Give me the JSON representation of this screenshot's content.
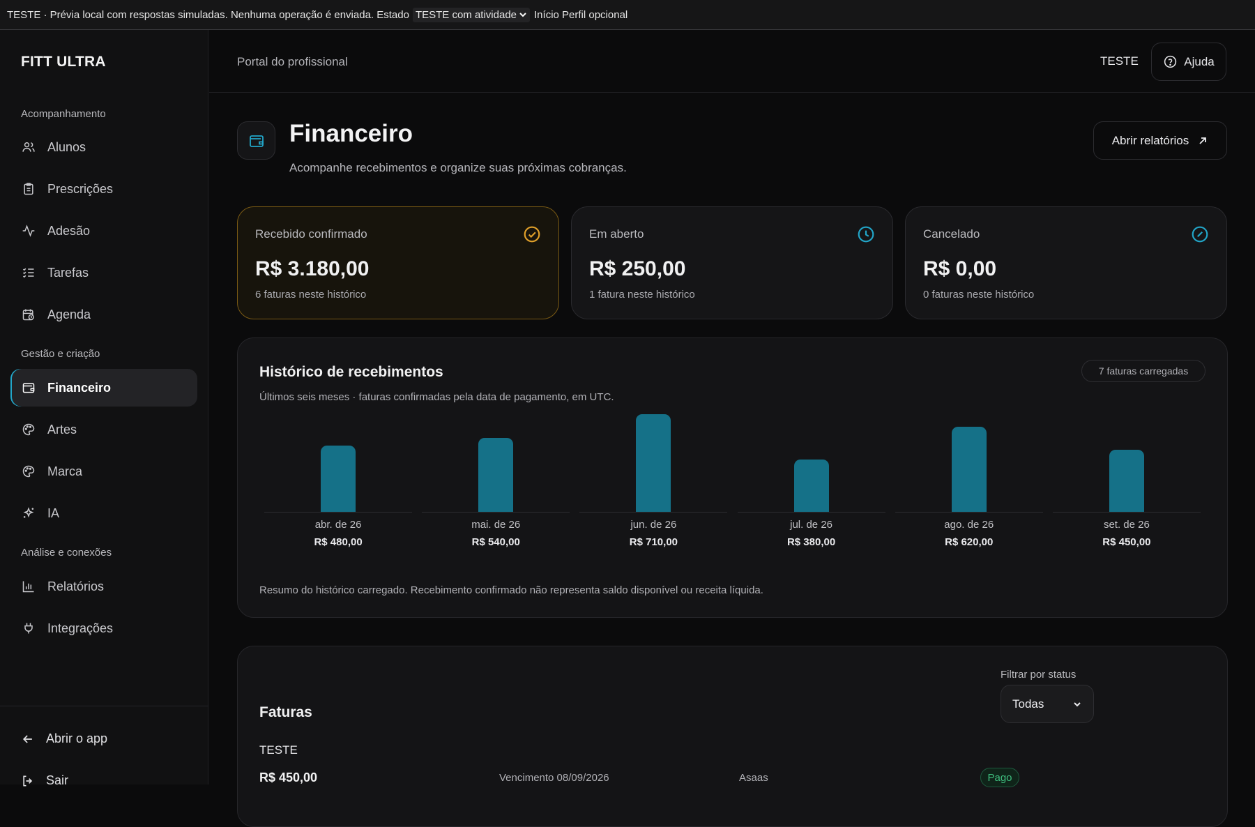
{
  "topbar": {
    "text": "TESTE · Prévia local com respostas simuladas. Nenhuma operação é enviada. Estado",
    "state_select": "TESTE com atividade",
    "links": "Início Perfil opcional"
  },
  "sidebar": {
    "brand": "FITT ULTRA",
    "sections": [
      "Acompanhamento",
      "Gestão e criação",
      "Análise e conexões"
    ],
    "items": [
      {
        "label": "Alunos",
        "icon": "users-icon"
      },
      {
        "label": "Prescrições",
        "icon": "clipboard-icon"
      },
      {
        "label": "Adesão",
        "icon": "activity-icon"
      },
      {
        "label": "Tarefas",
        "icon": "checklist-icon"
      },
      {
        "label": "Agenda",
        "icon": "calendar-clock-icon"
      },
      {
        "label": "Financeiro",
        "icon": "wallet-icon",
        "active": true
      },
      {
        "label": "Artes",
        "icon": "palette-icon"
      },
      {
        "label": "Marca",
        "icon": "palette-icon"
      },
      {
        "label": "IA",
        "icon": "sparkles-icon"
      },
      {
        "label": "Relatórios",
        "icon": "bar-chart-icon"
      },
      {
        "label": "Integrações",
        "icon": "plug-icon"
      }
    ],
    "footer": {
      "open_app": "Abrir o app",
      "logout": "Sair"
    }
  },
  "header": {
    "portal": "Portal do profissional",
    "user": "TESTE",
    "help": "Ajuda"
  },
  "page": {
    "title": "Financeiro",
    "subtitle": "Acompanhe recebimentos e organize suas próximas cobranças.",
    "reports_button": "Abrir relatórios"
  },
  "cards": [
    {
      "label": "Recebido confirmado",
      "value": "R$ 3.180,00",
      "count": "6 faturas neste histórico",
      "icon": "check-circle-icon",
      "color": "#e0a02a"
    },
    {
      "label": "Em aberto",
      "value": "R$ 250,00",
      "count": "1 fatura neste histórico",
      "icon": "clock-icon",
      "color": "#22a6c9"
    },
    {
      "label": "Cancelado",
      "value": "R$ 0,00",
      "count": "0 faturas neste histórico",
      "icon": "slash-circle-icon",
      "color": "#22a6c9"
    }
  ],
  "history": {
    "title": "Histórico de recebimentos",
    "subtitle": "Últimos seis meses · faturas confirmadas pela data de pagamento, em UTC.",
    "pill": "7 faturas carregadas",
    "note": "Resumo do histórico carregado. Recebimento confirmado não representa saldo disponível ou receita líquida.",
    "value_labels": [
      "R$ 480,00",
      "R$ 540,00",
      "R$ 710,00",
      "R$ 380,00",
      "R$ 620,00",
      "R$ 450,00"
    ]
  },
  "chart_data": {
    "type": "bar",
    "categories": [
      "abr. de 26",
      "mai. de 26",
      "jun. de 26",
      "jul. de 26",
      "ago. de 26",
      "set. de 26"
    ],
    "values": [
      480,
      540,
      710,
      380,
      620,
      450
    ],
    "bar_color": "#157188",
    "title": "Histórico de recebimentos",
    "grid": false
  },
  "invoices": {
    "title": "Faturas",
    "filter_label": "Filtrar por status",
    "filter_value": "Todas",
    "rows": [
      {
        "name": "TESTE",
        "amount": "R$ 450,00",
        "due": "Vencimento 08/09/2026",
        "gateway": "Asaas",
        "status": "Pago"
      }
    ]
  }
}
